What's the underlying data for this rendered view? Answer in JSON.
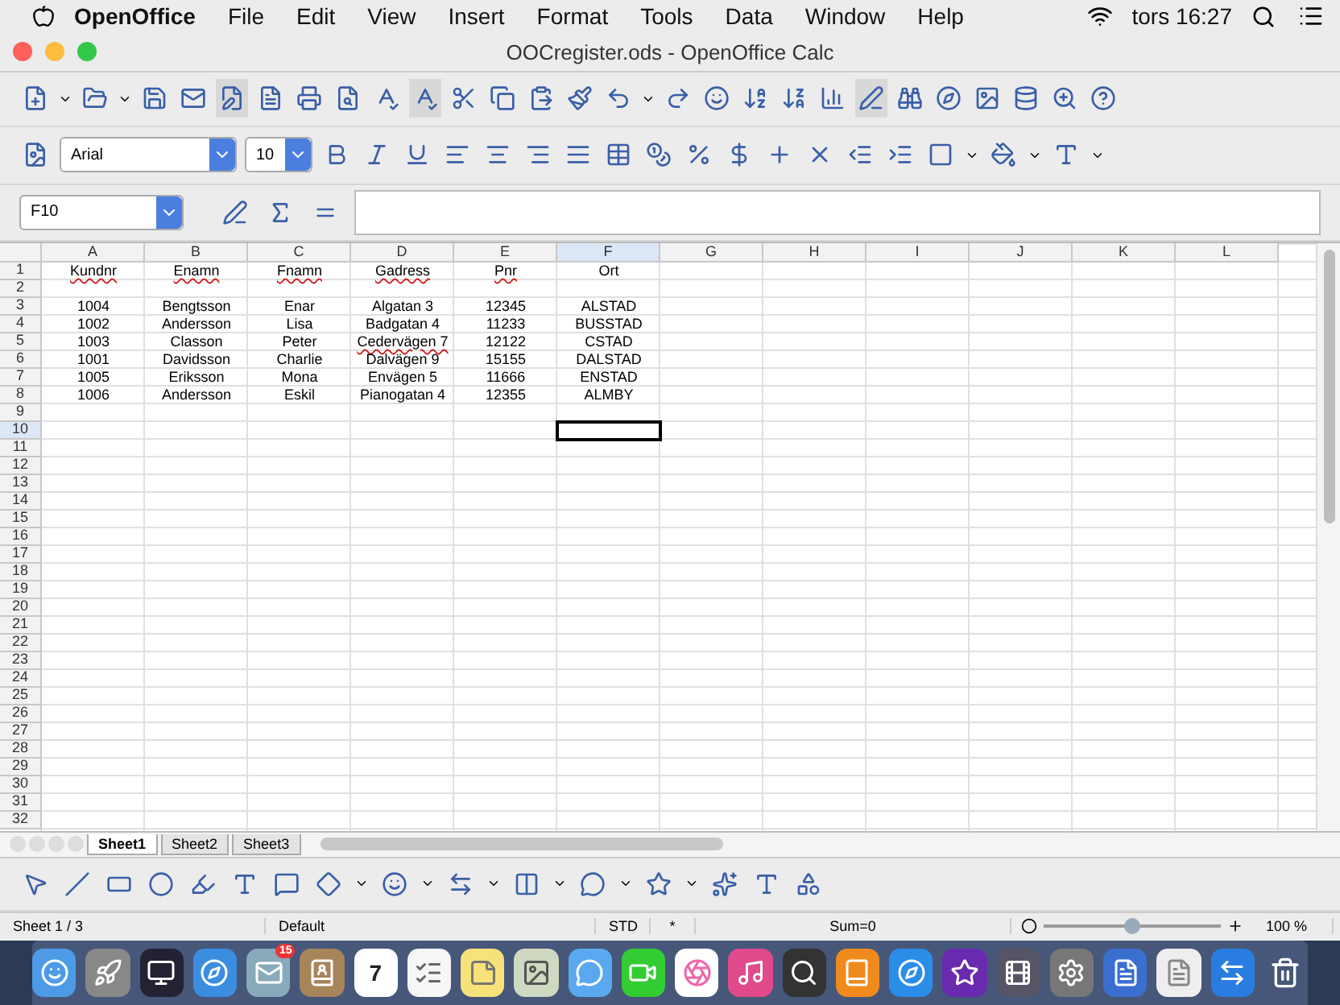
{
  "menubar": {
    "app": "OpenOffice",
    "items": [
      "File",
      "Edit",
      "View",
      "Insert",
      "Format",
      "Tools",
      "Data",
      "Window",
      "Help"
    ],
    "clock": "tors 16:27"
  },
  "window": {
    "title": "OOCregister.ods - OpenOffice Calc"
  },
  "formatting": {
    "font": "Arial",
    "size": "10"
  },
  "formula_bar": {
    "name_box": "F10"
  },
  "grid": {
    "columns": [
      {
        "label": "A",
        "selected": false
      },
      {
        "label": "B",
        "selected": false
      },
      {
        "label": "C",
        "selected": false
      },
      {
        "label": "D",
        "selected": false
      },
      {
        "label": "E",
        "selected": false
      },
      {
        "label": "F",
        "selected": true
      },
      {
        "label": "G",
        "selected": false
      },
      {
        "label": "H",
        "selected": false
      },
      {
        "label": "I",
        "selected": false
      },
      {
        "label": "J",
        "selected": false
      },
      {
        "label": "K",
        "selected": false
      },
      {
        "label": "L",
        "selected": false
      }
    ],
    "rows": [
      {
        "label": "1",
        "selected": false,
        "cells": [
          {
            "text": "Kundnr",
            "misspelled": true
          },
          {
            "text": "Enamn",
            "misspelled": true
          },
          {
            "text": "Fnamn",
            "misspelled": true
          },
          {
            "text": "Gadress",
            "misspelled": true
          },
          {
            "text": "Pnr",
            "misspelled": true
          },
          {
            "text": "Ort",
            "misspelled": false
          }
        ]
      },
      {
        "label": "2",
        "selected": false
      },
      {
        "label": "3",
        "selected": false,
        "cells": [
          {
            "text": "1004",
            "misspelled": false
          },
          {
            "text": "Bengtsson",
            "misspelled": false
          },
          {
            "text": "Enar",
            "misspelled": false
          },
          {
            "text": "Algatan 3",
            "misspelled": false
          },
          {
            "text": "12345",
            "misspelled": false
          },
          {
            "text": "ALSTAD",
            "misspelled": false
          }
        ]
      },
      {
        "label": "4",
        "selected": false,
        "cells": [
          {
            "text": "1002",
            "misspelled": false
          },
          {
            "text": "Andersson",
            "misspelled": false
          },
          {
            "text": "Lisa",
            "misspelled": false
          },
          {
            "text": "Badgatan 4",
            "misspelled": false
          },
          {
            "text": "11233",
            "misspelled": false
          },
          {
            "text": "BUSSTAD",
            "misspelled": false
          }
        ]
      },
      {
        "label": "5",
        "selected": false,
        "cells": [
          {
            "text": "1003",
            "misspelled": false
          },
          {
            "text": "Classon",
            "misspelled": false
          },
          {
            "text": "Peter",
            "misspelled": false
          },
          {
            "text": "Cedervägen 7",
            "misspelled": true
          },
          {
            "text": "12122",
            "misspelled": false
          },
          {
            "text": "CSTAD",
            "misspelled": false
          }
        ]
      },
      {
        "label": "6",
        "selected": false,
        "cells": [
          {
            "text": "1001",
            "misspelled": false
          },
          {
            "text": "Davidsson",
            "misspelled": false
          },
          {
            "text": "Charlie",
            "misspelled": false
          },
          {
            "text": "Dalvägen 9",
            "misspelled": false
          },
          {
            "text": "15155",
            "misspelled": false
          },
          {
            "text": "DALSTAD",
            "misspelled": false
          }
        ]
      },
      {
        "label": "7",
        "selected": false,
        "cells": [
          {
            "text": "1005",
            "misspelled": false
          },
          {
            "text": "Eriksson",
            "misspelled": false
          },
          {
            "text": "Mona",
            "misspelled": false
          },
          {
            "text": "Envägen 5",
            "misspelled": false
          },
          {
            "text": "11666",
            "misspelled": false
          },
          {
            "text": "ENSTAD",
            "misspelled": false
          }
        ]
      },
      {
        "label": "8",
        "selected": false,
        "cells": [
          {
            "text": "1006",
            "misspelled": false
          },
          {
            "text": "Andersson",
            "misspelled": false
          },
          {
            "text": "Eskil",
            "misspelled": false
          },
          {
            "text": "Pianogatan 4",
            "misspelled": false
          },
          {
            "text": "12355",
            "misspelled": false
          },
          {
            "text": "ALMBY",
            "misspelled": false
          }
        ]
      },
      {
        "label": "9",
        "selected": false
      },
      {
        "label": "10",
        "selected": true
      },
      {
        "label": "11",
        "selected": false
      },
      {
        "label": "12",
        "selected": false
      },
      {
        "label": "13",
        "selected": false
      },
      {
        "label": "14",
        "selected": false
      },
      {
        "label": "15",
        "selected": false
      },
      {
        "label": "16",
        "selected": false
      },
      {
        "label": "17",
        "selected": false
      },
      {
        "label": "18",
        "selected": false
      },
      {
        "label": "19",
        "selected": false
      },
      {
        "label": "20",
        "selected": false
      },
      {
        "label": "21",
        "selected": false
      },
      {
        "label": "22",
        "selected": false
      },
      {
        "label": "23",
        "selected": false
      },
      {
        "label": "24",
        "selected": false
      },
      {
        "label": "25",
        "selected": false
      },
      {
        "label": "26",
        "selected": false
      },
      {
        "label": "27",
        "selected": false
      },
      {
        "label": "28",
        "selected": false
      },
      {
        "label": "29",
        "selected": false
      },
      {
        "label": "30",
        "selected": false
      },
      {
        "label": "31",
        "selected": false
      },
      {
        "label": "32",
        "selected": false
      }
    ]
  },
  "sheet_tabs": [
    {
      "label": "Sheet1",
      "selected": true
    },
    {
      "label": "Sheet2",
      "selected": false
    },
    {
      "label": "Sheet3",
      "selected": false
    }
  ],
  "status_bar": {
    "sheet": "Sheet 1 / 3",
    "style": "Default",
    "mode": "STD",
    "modified": "*",
    "sum": "Sum=0",
    "zoom": {
      "level": 0.5
    },
    "zoom_text": "100 %"
  },
  "dock": {
    "mail_badge": "15",
    "calendar_day": "7"
  }
}
